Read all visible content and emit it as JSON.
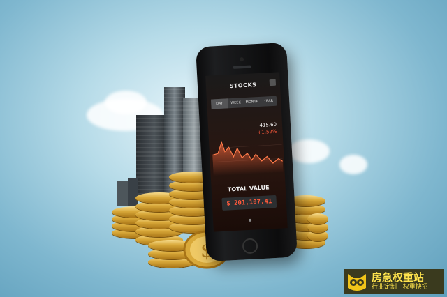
{
  "phone": {
    "screen_title": "STOCKS",
    "tabs": [
      {
        "label": "DAY"
      },
      {
        "label": "WEEK"
      },
      {
        "label": "MONTH"
      },
      {
        "label": "YEAR"
      }
    ],
    "quote_value": "415.60",
    "quote_change": "+1.52%",
    "total_label": "TOTAL VALUE",
    "total_amount": "$ 201,107.41"
  },
  "watermark": {
    "title": "房急权重站",
    "subtitle": "行业定制 | 权重快招"
  },
  "colors": {
    "accent": "#ff5a3c",
    "gold": "#d9a93a",
    "watermark_text": "#ffe44d"
  }
}
